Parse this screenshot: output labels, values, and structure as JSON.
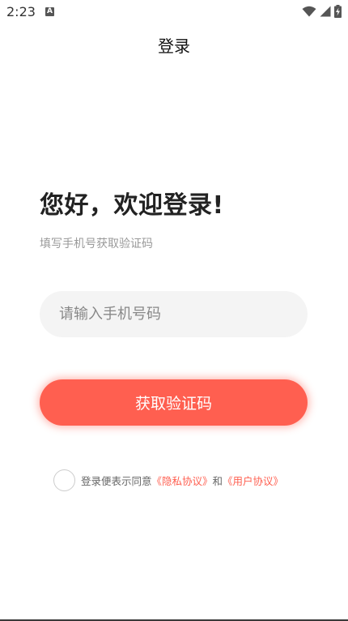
{
  "status_bar": {
    "time": "2:23",
    "notification_glyph": "A",
    "icons": [
      "wifi-icon",
      "signal-icon",
      "battery-charging-icon"
    ]
  },
  "nav": {
    "title": "登录"
  },
  "main": {
    "welcome": "您好，欢迎登录!",
    "subtitle": "填写手机号获取验证码",
    "phone_input": {
      "value": "",
      "placeholder": "请输入手机号码"
    },
    "get_code_label": "获取验证码"
  },
  "agreement": {
    "prefix": "登录便表示同意",
    "privacy_link": "《隐私协议》",
    "connector": "和",
    "user_link": "《用户协议》"
  },
  "colors": {
    "accent": "#ff5f50",
    "input_bg": "#f4f4f4",
    "subtitle": "#9a9a9a"
  }
}
